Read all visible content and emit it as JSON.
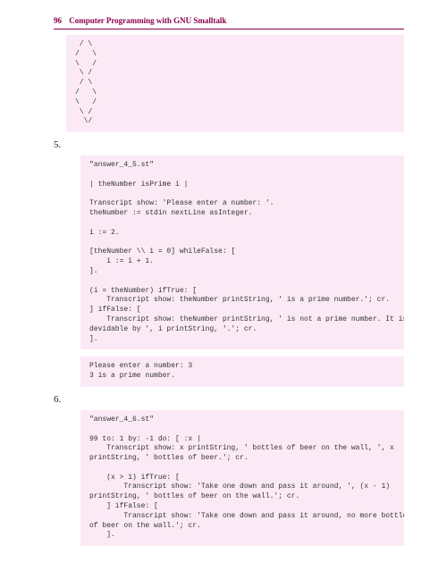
{
  "header": {
    "page": "96",
    "title": "Computer Programming with GNU Smalltalk"
  },
  "diamond": " / \\\n/   \\\n\\   /\n \\ /\n / \\\n/   \\\n\\   /\n \\ /\n  \\/",
  "num5": "5.",
  "code5": "\"answer_4_5.st\"\n\n| theNumber isPrime i |\n\nTranscript show: 'Please enter a number: '.\ntheNumber := stdin nextLine asInteger.\n\ni := 2.\n\n[theNumber \\\\ i = 0] whileFalse: [\n    i := i + 1.\n].\n\n(i = theNumber) ifTrue: [\n    Transcript show: theNumber printString, ' is a prime number.'; cr.\n] ifFalse: [\n    Transcript show: theNumber printString, ' is not a prime number. It is\ndevidable by ', i printString, '.'; cr.\n].",
  "output5": "Please enter a number: 3\n3 is a prime number.",
  "num6": "6.",
  "code6": "\"answer_4_6.st\"\n\n99 to: 1 by: -1 do: [ :x |\n    Transcript show: x printString, ' bottles of beer on the wall, ', x\nprintString, ' bottles of beer.'; cr.\n\n    (x > 1) ifTrue: [\n        Transcript show: 'Take one down and pass it around, ', (x - 1)\nprintString, ' bottles of beer on the wall.'; cr.\n    ] ifFalse: [\n        Transcript show: 'Take one down and pass it around, no more bottles\nof beer on the wall.'; cr.\n    ]."
}
